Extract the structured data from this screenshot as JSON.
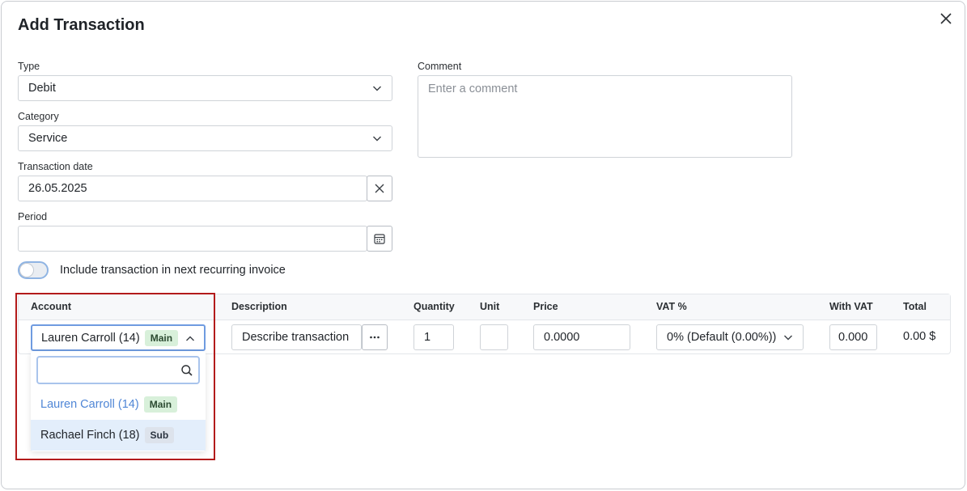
{
  "dialog": {
    "title": "Add Transaction",
    "close_icon": "close-icon"
  },
  "form": {
    "type": {
      "label": "Type",
      "value": "Debit"
    },
    "category": {
      "label": "Category",
      "value": "Service"
    },
    "transaction_date": {
      "label": "Transaction date",
      "value": "26.05.2025"
    },
    "period": {
      "label": "Period",
      "value": ""
    },
    "comment": {
      "label": "Comment",
      "placeholder": "Enter a comment"
    },
    "recurring_toggle": {
      "label": "Include transaction in next recurring invoice",
      "checked": false
    }
  },
  "table": {
    "headers": {
      "account": "Account",
      "description": "Description",
      "quantity": "Quantity",
      "unit": "Unit",
      "price": "Price",
      "vat": "VAT %",
      "with_vat": "With VAT",
      "total": "Total"
    },
    "row": {
      "account": {
        "name": "Lauren Carroll (14)",
        "badge": "Main"
      },
      "description_placeholder": "Describe transaction",
      "quantity": "1",
      "unit": "",
      "price": "0.0000",
      "vat": "0% (Default (0.00%))",
      "with_vat": "0.000",
      "total": "0.00 $"
    }
  },
  "account_dropdown": {
    "search_value": "",
    "options": [
      {
        "name": "Lauren Carroll (14)",
        "badge": "Main",
        "selected": true
      },
      {
        "name": "Rachael Finch (18)",
        "badge": "Sub",
        "hovered": true
      }
    ]
  },
  "colors": {
    "accent_blue": "#4f86d6",
    "focus_border": "#6f9be0",
    "highlight_red": "#b31b1b",
    "hover_bg": "#e3eefb"
  }
}
